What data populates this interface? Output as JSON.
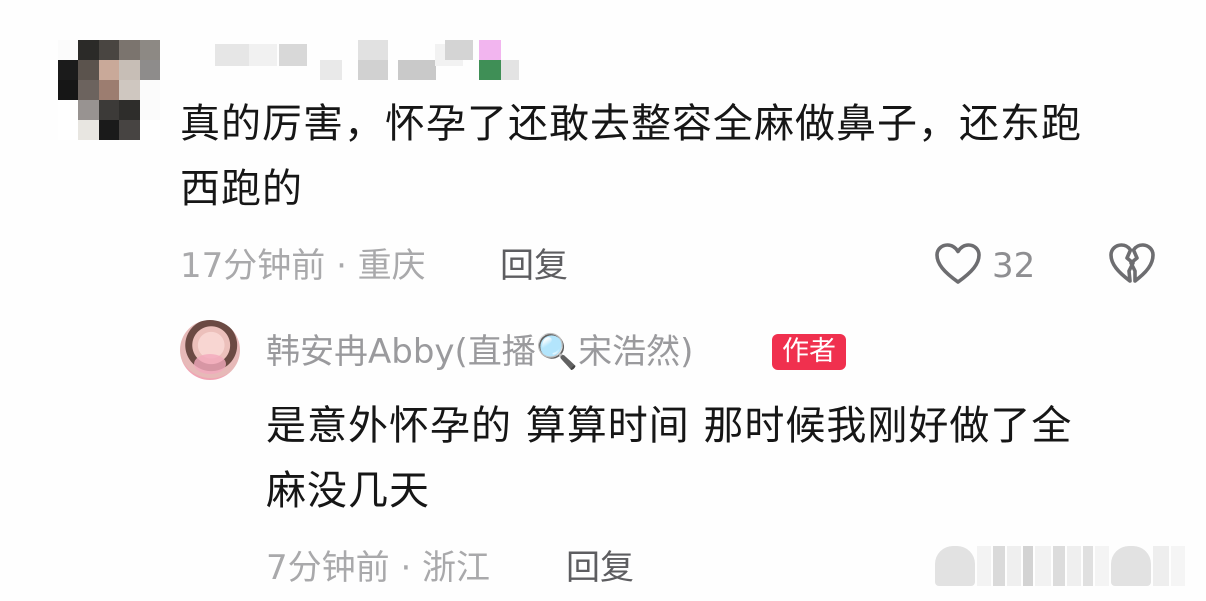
{
  "comment": {
    "text_line1": "真的厉害，怀孕了还敢去整容全麻做鼻子，还东跑",
    "text_line2": "西跑的",
    "time_location": "17分钟前 · 重庆",
    "reply_label": "回复",
    "like_count": "32"
  },
  "reply": {
    "author_name": "韩安冉Abby(直播🔍宋浩然)",
    "author_badge": "作者",
    "text_line1": "是意外怀孕的 算算时间 那时候我刚好做了全",
    "text_line2": "麻没几天",
    "time_location": "7分钟前 · 浙江",
    "reply_label": "回复"
  },
  "icons": {
    "like": "heart-outline-icon",
    "dislike": "broken-heart-icon"
  },
  "colors": {
    "badge_bg": "#f0304e",
    "meta_text": "#a9a9ab",
    "reply_button_text": "#5d5d60",
    "body_text": "#161616"
  }
}
